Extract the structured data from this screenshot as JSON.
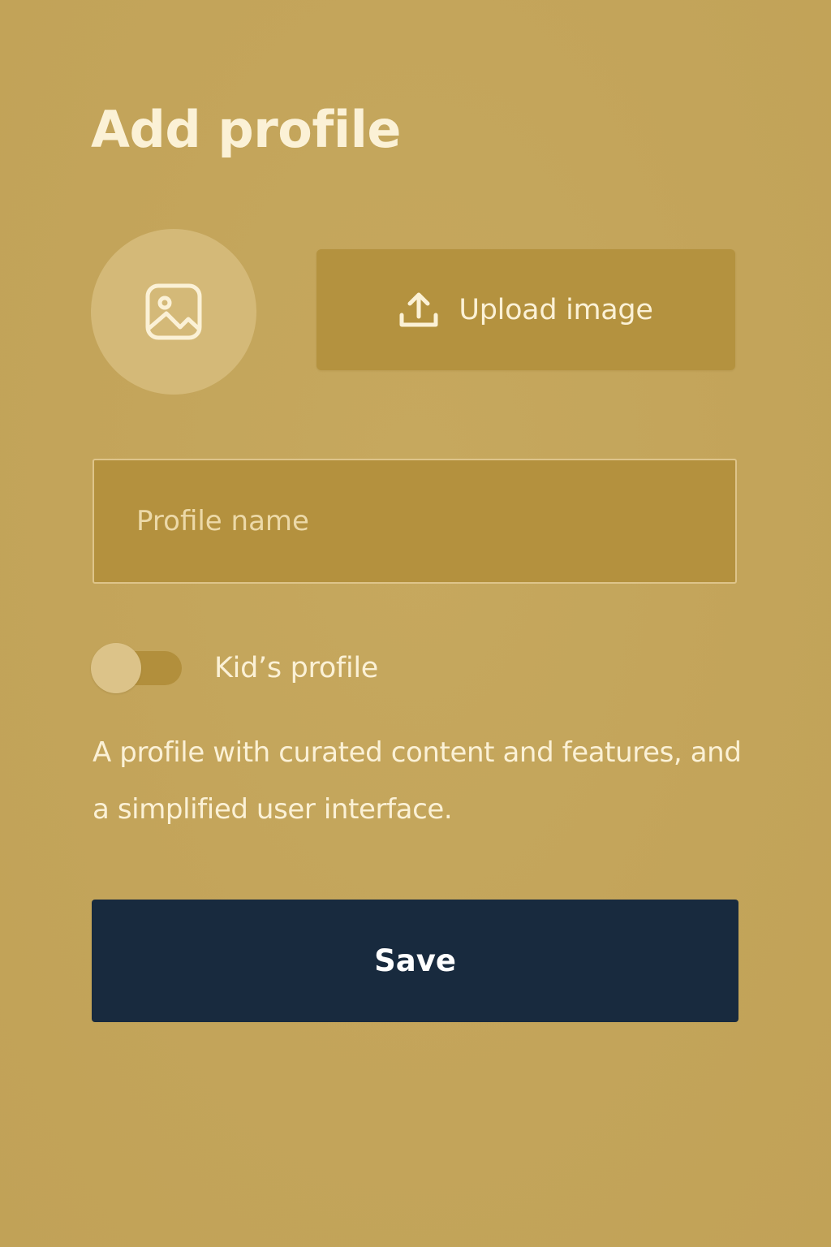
{
  "page": {
    "title": "Add profile"
  },
  "avatar": {
    "icon": "image-icon"
  },
  "upload": {
    "icon": "upload-icon",
    "label": "Upload image"
  },
  "profile_name": {
    "placeholder": "Profile name",
    "value": ""
  },
  "kids_toggle": {
    "label": "Kid’s profile",
    "enabled": false
  },
  "description": "A profile with curated content and features, and a simplified user interface.",
  "save": {
    "label": "Save"
  },
  "colors": {
    "background": "#c4a65b",
    "accent_dark": "#182a3e",
    "text_light": "#fbf1d6",
    "field_fill": "#b4913e"
  }
}
